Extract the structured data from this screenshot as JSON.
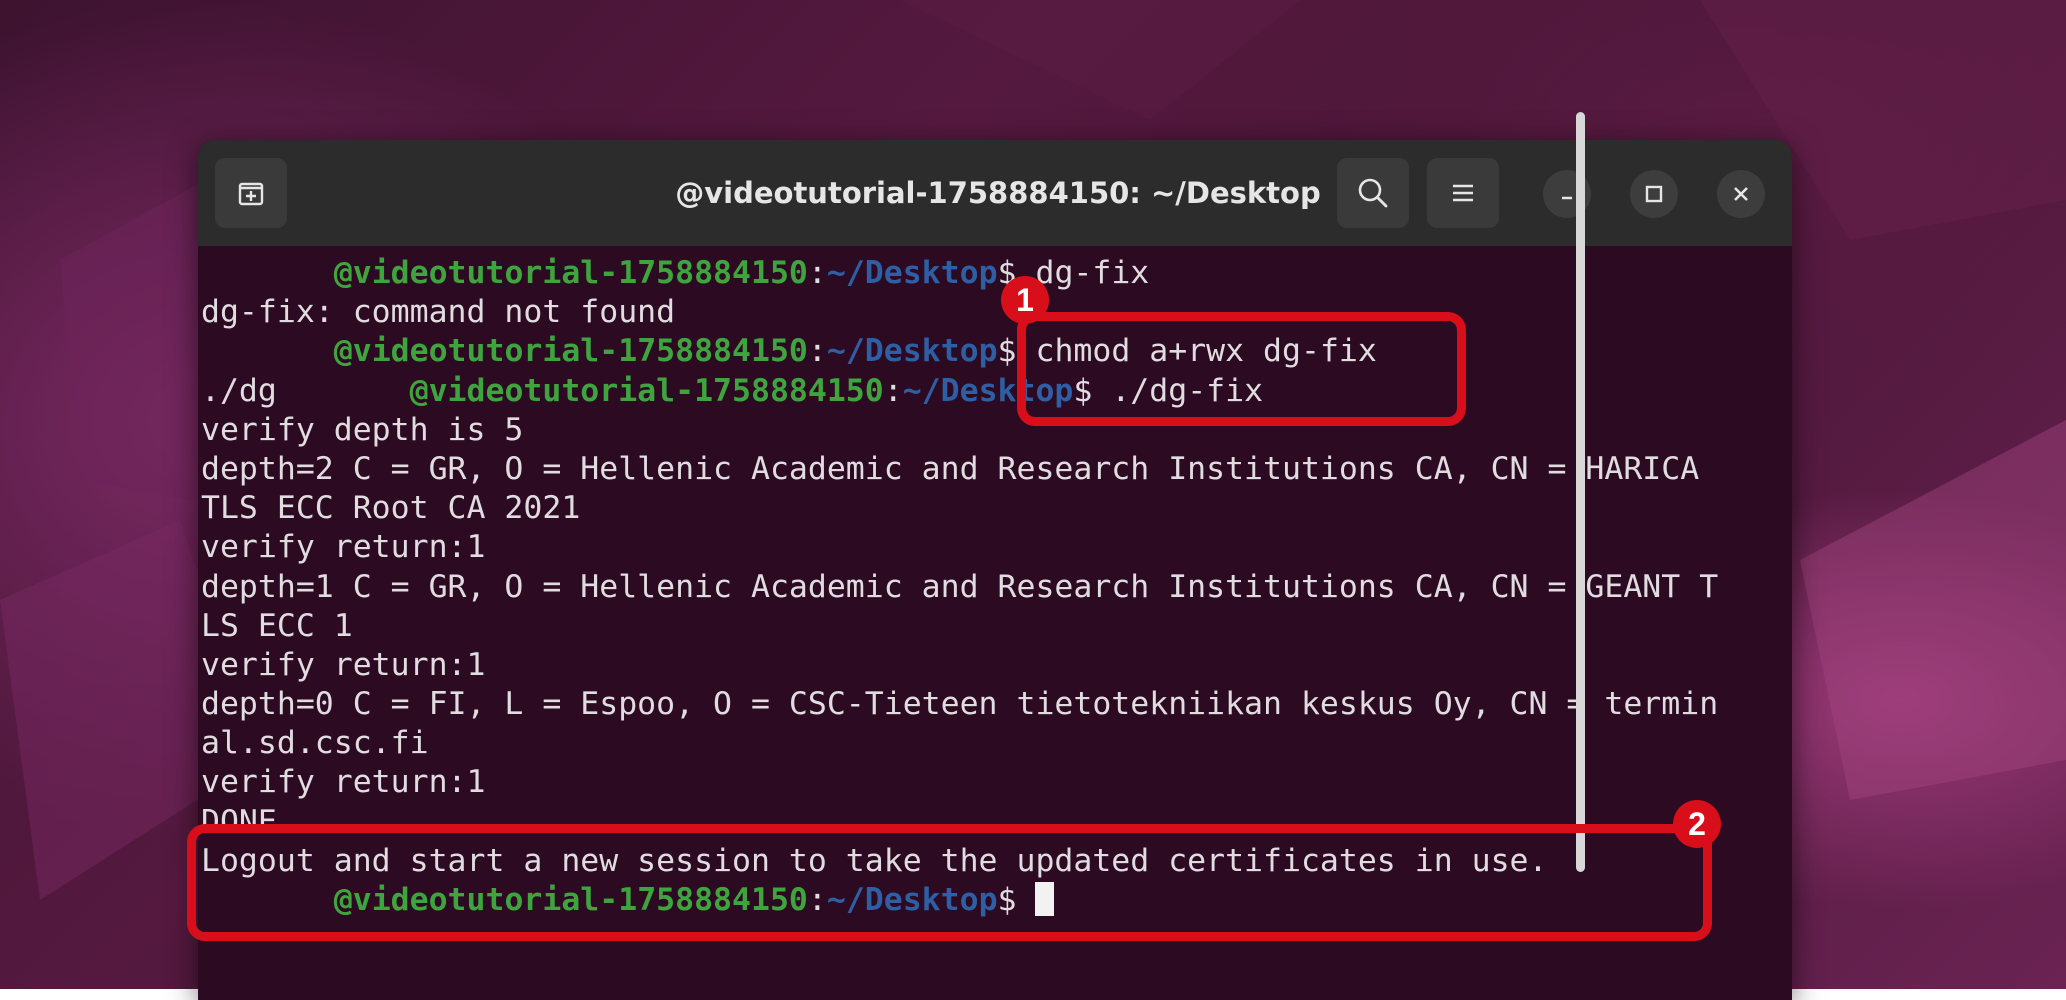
{
  "window": {
    "title": "@videotutorial-1758884150: ~/Desktop"
  },
  "titlebar_icons": {
    "new_tab": "new-tab-icon",
    "search": "search-icon",
    "menu": "hamburger-menu-icon",
    "minimize": "minimize-icon",
    "maximize": "maximize-icon",
    "close": "close-icon"
  },
  "terminal": {
    "lines": [
      {
        "indent": "       ",
        "user": "@videotutorial-1758884150",
        "sep": ":",
        "path": "~/Desktop",
        "text": "$ dg-fix"
      },
      {
        "text": "dg-fix: command not found"
      },
      {
        "indent": "       ",
        "user": "@videotutorial-1758884150",
        "sep": ":",
        "path": "~/Desktop",
        "text": "$ chmod a+rwx dg-fix"
      },
      {
        "lead": "./dg       ",
        "user": "@videotutorial-1758884150",
        "sep": ":",
        "path": "~/Desktop",
        "text": "$ ./dg-fix"
      },
      {
        "text": "verify depth is 5"
      },
      {
        "text": "depth=2 C = GR, O = Hellenic Academic and Research Institutions CA, CN = HARICA"
      },
      {
        "text": "TLS ECC Root CA 2021"
      },
      {
        "text": "verify return:1"
      },
      {
        "text": "depth=1 C = GR, O = Hellenic Academic and Research Institutions CA, CN = GEANT T"
      },
      {
        "text": "LS ECC 1"
      },
      {
        "text": "verify return:1"
      },
      {
        "text": "depth=0 C = FI, L = Espoo, O = CSC-Tieteen tietotekniikan keskus Oy, CN = termin"
      },
      {
        "text": "al.sd.csc.fi"
      },
      {
        "text": "verify return:1"
      },
      {
        "text": "DONE"
      },
      {
        "text": "Logout and start a new session to take the updated certificates in use."
      },
      {
        "indent": "       ",
        "user": "@videotutorial-1758884150",
        "sep": ":",
        "path": "~/Desktop",
        "text": "$ ",
        "cursor": true
      }
    ]
  },
  "annotations": {
    "badge_1": "1",
    "badge_2": "2"
  },
  "colors": {
    "terminal_bg": "#2c0b22",
    "prompt_user": "#3ea53e",
    "prompt_path": "#2e5ea3",
    "highlight": "#d80f1b"
  }
}
